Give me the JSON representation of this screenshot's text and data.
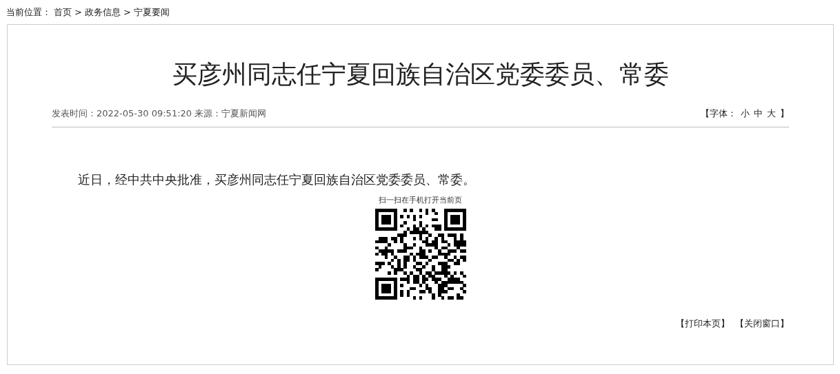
{
  "breadcrumb": {
    "label": "当前位置：",
    "links": [
      "首页",
      "政务信息",
      "宁夏要闻"
    ],
    "separator": ">"
  },
  "article": {
    "title": "买彦州同志任宁夏回族自治区党委委员、常委",
    "meta": "发表时间：2022-05-30 09:51:20 来源：宁夏新闻网",
    "font_size": {
      "open": "【字体：",
      "options": [
        "小",
        "中",
        "大"
      ],
      "close": "】"
    },
    "body": "近日，经中共中央批准，买彦州同志任宁夏回族自治区党委委员、常委。",
    "qr_caption": "扫一扫在手机打开当前页"
  },
  "actions": [
    "【打印本页】",
    "【关闭窗口】"
  ]
}
